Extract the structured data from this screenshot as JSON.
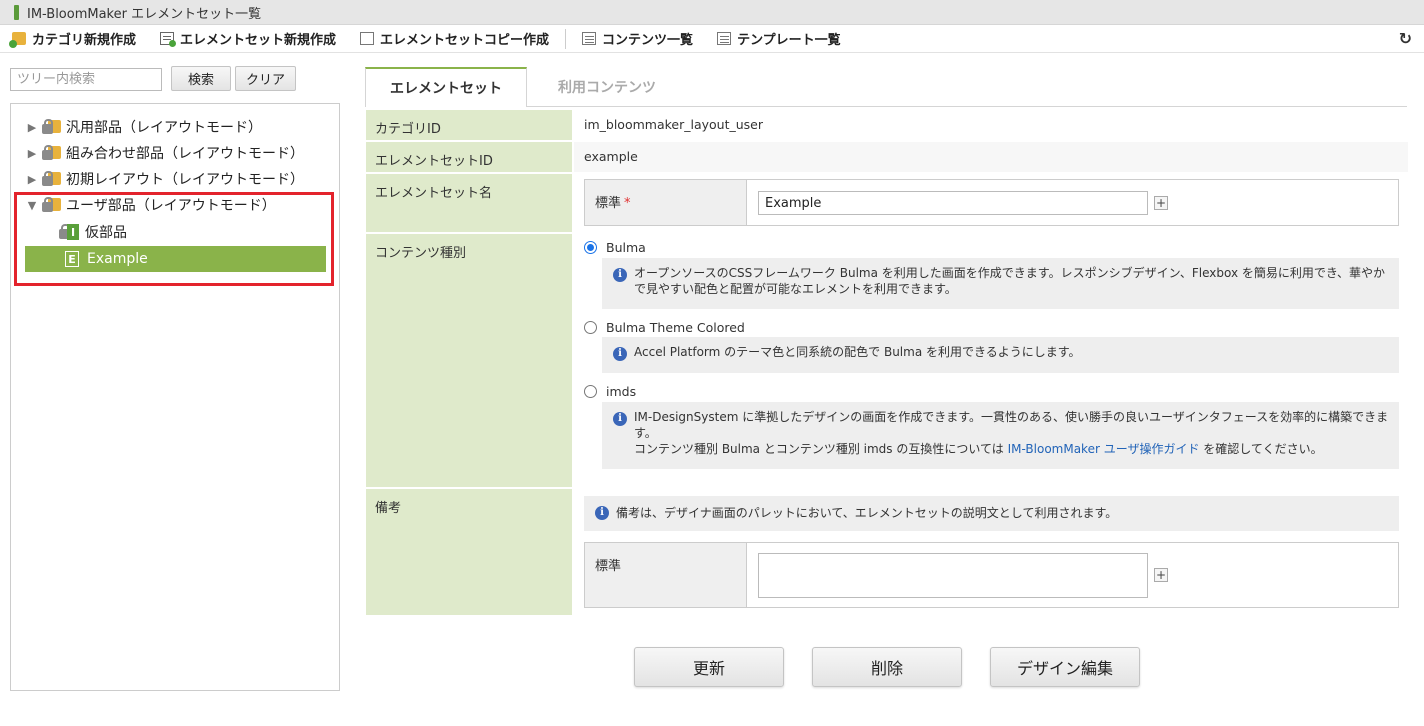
{
  "window": {
    "title": "IM-BloomMaker エレメントセット一覧"
  },
  "toolbar": {
    "items": [
      {
        "label": "カテゴリ新規作成",
        "icon": "folder-add-icon"
      },
      {
        "label": "エレメントセット新規作成",
        "icon": "list-add-icon"
      },
      {
        "label": "エレメントセットコピー作成",
        "icon": "copy-icon"
      },
      {
        "label": "コンテンツ一覧",
        "icon": "list-icon"
      },
      {
        "label": "テンプレート一覧",
        "icon": "list-icon"
      }
    ],
    "refresh_glyph": "↻"
  },
  "search": {
    "placeholder": "ツリー内検索",
    "value": "",
    "search_label": "検索",
    "clear_label": "クリア"
  },
  "tree": {
    "nodes": [
      {
        "label": "汎用部品（レイアウトモード）",
        "expanded": false
      },
      {
        "label": "組み合わせ部品（レイアウトモード）",
        "expanded": false
      },
      {
        "label": "初期レイアウト（レイアウトモード）",
        "expanded": false
      },
      {
        "label": "ユーザ部品（レイアウトモード）",
        "expanded": true
      }
    ],
    "children": [
      {
        "label": "仮部品",
        "badge": "I"
      },
      {
        "label": "Example",
        "badge": "E",
        "selected": true
      }
    ]
  },
  "tabs": [
    {
      "label": "エレメントセット",
      "active": true
    },
    {
      "label": "利用コンテンツ",
      "active": false
    }
  ],
  "form": {
    "category_id": {
      "label": "カテゴリID",
      "value": "im_bloommaker_layout_user"
    },
    "element_set_id": {
      "label": "エレメントセットID",
      "value": "example"
    },
    "element_set_name": {
      "label": "エレメントセット名",
      "locale_label": "標準",
      "required_mark": "*",
      "value": "Example"
    },
    "content_type": {
      "label": "コンテンツ種別",
      "options": [
        {
          "label": "Bulma",
          "selected": true,
          "info": "オープンソースのCSSフレームワーク Bulma を利用した画面を作成できます。レスポンシブデザイン、Flexbox を簡易に利用でき、華やかで見やすい配色と配置が可能なエレメントを利用できます。"
        },
        {
          "label": "Bulma Theme Colored",
          "selected": false,
          "info": "Accel Platform のテーマ色と同系統の配色で Bulma を利用できるようにします。"
        },
        {
          "label": "imds",
          "selected": false,
          "info": "IM-DesignSystem に準拠したデザインの画面を作成できます。一貫性のある、使い勝手の良いユーザインタフェースを効率的に構築できます。",
          "info2_prefix": "コンテンツ種別 Bulma とコンテンツ種別 imds の互換性については",
          "info2_link": "IM-BloomMaker ユーザ操作ガイド",
          "info2_suffix": "を確認してください。"
        }
      ]
    },
    "remarks": {
      "label": "備考",
      "info": "備考は、デザイナ画面のパレットにおいて、エレメントセットの説明文として利用されます。",
      "locale_label": "標準",
      "value": ""
    }
  },
  "actions": {
    "update_label": "更新",
    "delete_label": "削除",
    "design_edit_label": "デザイン編集"
  }
}
